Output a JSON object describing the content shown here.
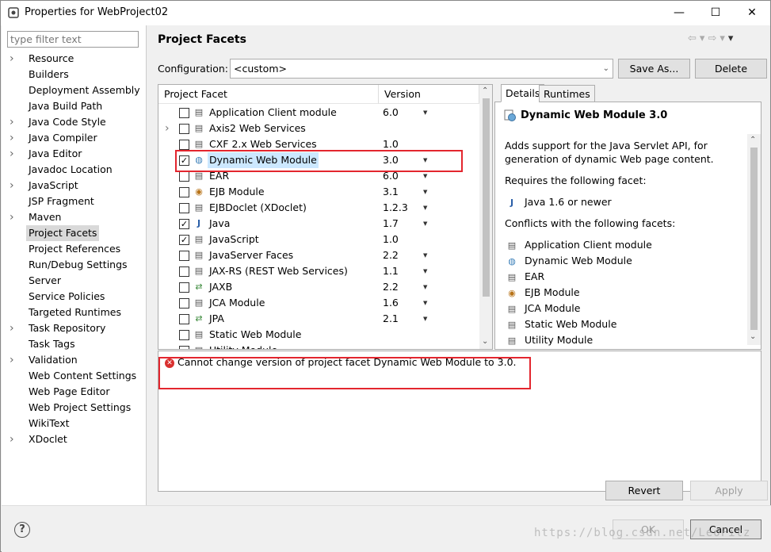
{
  "window": {
    "title": "Properties for WebProject02",
    "minimize": "—",
    "maximize": "☐",
    "close": "✕"
  },
  "filter": {
    "placeholder": "type filter text"
  },
  "nav": [
    {
      "label": "Resource",
      "expandable": true
    },
    {
      "label": "Builders",
      "expandable": false
    },
    {
      "label": "Deployment Assembly",
      "expandable": false
    },
    {
      "label": "Java Build Path",
      "expandable": false
    },
    {
      "label": "Java Code Style",
      "expandable": true
    },
    {
      "label": "Java Compiler",
      "expandable": true
    },
    {
      "label": "Java Editor",
      "expandable": true
    },
    {
      "label": "Javadoc Location",
      "expandable": false
    },
    {
      "label": "JavaScript",
      "expandable": true
    },
    {
      "label": "JSP Fragment",
      "expandable": false
    },
    {
      "label": "Maven",
      "expandable": true
    },
    {
      "label": "Project Facets",
      "expandable": false,
      "selected": true
    },
    {
      "label": "Project References",
      "expandable": false
    },
    {
      "label": "Run/Debug Settings",
      "expandable": false
    },
    {
      "label": "Server",
      "expandable": false
    },
    {
      "label": "Service Policies",
      "expandable": false
    },
    {
      "label": "Targeted Runtimes",
      "expandable": false
    },
    {
      "label": "Task Repository",
      "expandable": true
    },
    {
      "label": "Task Tags",
      "expandable": false
    },
    {
      "label": "Validation",
      "expandable": true
    },
    {
      "label": "Web Content Settings",
      "expandable": false
    },
    {
      "label": "Web Page Editor",
      "expandable": false
    },
    {
      "label": "Web Project Settings",
      "expandable": false
    },
    {
      "label": "WikiText",
      "expandable": false
    },
    {
      "label": "XDoclet",
      "expandable": true
    }
  ],
  "page": {
    "title": "Project Facets",
    "config_label": "Configuration:",
    "config_value": "<custom>",
    "save_as": "Save As...",
    "delete": "Delete"
  },
  "facets": {
    "col_facet": "Project Facet",
    "col_version": "Version",
    "rows": [
      {
        "name": "Application Client module",
        "version": "6.0",
        "checked": false,
        "dropdown": true,
        "icon": "page-icon"
      },
      {
        "name": "Axis2 Web Services",
        "version": "",
        "checked": false,
        "dropdown": false,
        "expand": true,
        "icon": "page-icon"
      },
      {
        "name": "CXF 2.x Web Services",
        "version": "1.0",
        "checked": false,
        "dropdown": false,
        "icon": "page-icon"
      },
      {
        "name": "Dynamic Web Module",
        "version": "3.0",
        "checked": true,
        "dropdown": true,
        "selected": true,
        "icon": "globe-icon"
      },
      {
        "name": "EAR",
        "version": "6.0",
        "checked": false,
        "dropdown": true,
        "icon": "page-icon"
      },
      {
        "name": "EJB Module",
        "version": "3.1",
        "checked": false,
        "dropdown": true,
        "icon": "bean-icon"
      },
      {
        "name": "EJBDoclet (XDoclet)",
        "version": "1.2.3",
        "checked": false,
        "dropdown": true,
        "icon": "page-icon"
      },
      {
        "name": "Java",
        "version": "1.7",
        "checked": true,
        "dropdown": true,
        "icon": "java-icon"
      },
      {
        "name": "JavaScript",
        "version": "1.0",
        "checked": true,
        "dropdown": false,
        "icon": "page-icon"
      },
      {
        "name": "JavaServer Faces",
        "version": "2.2",
        "checked": false,
        "dropdown": true,
        "icon": "page-icon"
      },
      {
        "name": "JAX-RS (REST Web Services)",
        "version": "1.1",
        "checked": false,
        "dropdown": true,
        "icon": "page-icon"
      },
      {
        "name": "JAXB",
        "version": "2.2",
        "checked": false,
        "dropdown": true,
        "icon": "arrows-icon"
      },
      {
        "name": "JCA Module",
        "version": "1.6",
        "checked": false,
        "dropdown": true,
        "icon": "page-icon"
      },
      {
        "name": "JPA",
        "version": "2.1",
        "checked": false,
        "dropdown": true,
        "icon": "arrows-icon"
      },
      {
        "name": "Static Web Module",
        "version": "",
        "checked": false,
        "dropdown": false,
        "icon": "page-icon"
      },
      {
        "name": "Utility Module",
        "version": "",
        "checked": false,
        "dropdown": false,
        "icon": "page-icon"
      }
    ]
  },
  "details": {
    "tab_details": "Details",
    "tab_runtimes": "Runtimes",
    "heading": "Dynamic Web Module 3.0",
    "desc_line1": "Adds support for the Java Servlet API, for",
    "desc_line2": "generation of dynamic Web page content.",
    "requires_label": "Requires the following facet:",
    "requires": [
      {
        "name": "Java 1.6 or newer",
        "icon": "java-icon"
      }
    ],
    "conflicts_label": "Conflicts with the following facets:",
    "conflicts": [
      {
        "name": "Application Client module",
        "icon": "page-icon"
      },
      {
        "name": "Dynamic Web Module",
        "icon": "globe-icon"
      },
      {
        "name": "EAR",
        "icon": "page-icon"
      },
      {
        "name": "EJB Module",
        "icon": "bean-icon"
      },
      {
        "name": "JCA Module",
        "icon": "page-icon"
      },
      {
        "name": "Static Web Module",
        "icon": "page-icon"
      },
      {
        "name": "Utility Module",
        "icon": "page-icon"
      }
    ]
  },
  "message": {
    "text": "Cannot change version of project facet Dynamic Web Module to 3.0."
  },
  "buttons": {
    "revert": "Revert",
    "apply": "Apply",
    "ok": "OK",
    "cancel": "Cancel",
    "help": "?"
  },
  "watermark": "https://blog.csdn.net/LeoFitz",
  "colors": {
    "highlight_box": "#e3262e",
    "selection": "#cce8ff",
    "error": "#d9302f"
  }
}
